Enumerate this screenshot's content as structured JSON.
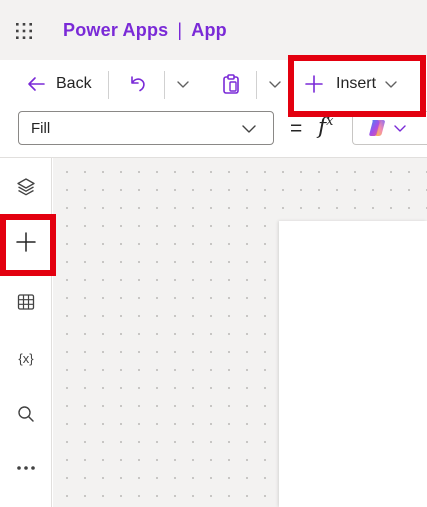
{
  "header": {
    "app_suite": "Power Apps",
    "separator": "|",
    "app_name": "App",
    "brand_color": "#7a2ad7",
    "waffle_icon": "app-launcher-icon"
  },
  "commandbar": {
    "back_label": "Back",
    "undo_icon": "undo-icon",
    "paste_icon": "paste-icon",
    "insert_label": "Insert",
    "insert_icon": "plus-icon"
  },
  "formula_bar": {
    "property_value": "Fill",
    "equals": "=",
    "fx_symbol": "f",
    "fx_sup": "x",
    "copilot_icon": "copilot-icon"
  },
  "left_rail": {
    "items": [
      {
        "icon": "layers-icon"
      },
      {
        "icon": "plus-icon"
      },
      {
        "icon": "table-icon"
      },
      {
        "icon": "variables-icon",
        "text": "{x}"
      },
      {
        "icon": "search-icon"
      },
      {
        "icon": "more-icon"
      }
    ]
  },
  "annotations": {
    "highlight_color": "#e3000f"
  }
}
